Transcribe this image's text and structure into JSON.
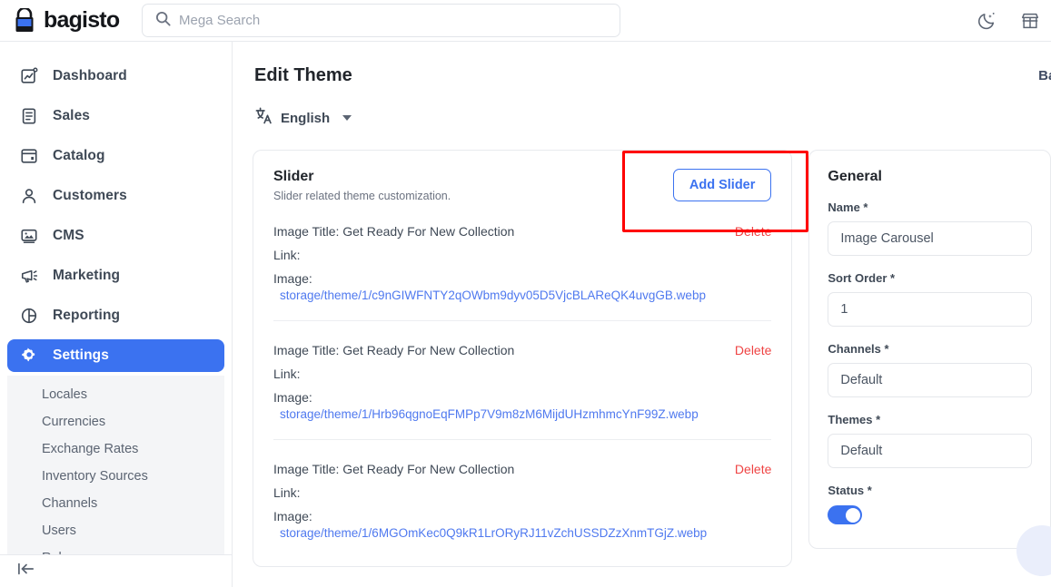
{
  "topbar": {
    "brand_name": "bagisto",
    "brand_icon": "shopping-bag-icon",
    "search_placeholder": "Mega Search",
    "search_value": "",
    "search_icon": "search-icon",
    "dark_mode_icon": "moon-icon",
    "store_icon": "shop-icon"
  },
  "sidebar": {
    "items": [
      {
        "label": "Dashboard",
        "icon": "dashboard-icon",
        "active": false
      },
      {
        "label": "Sales",
        "icon": "sales-icon",
        "active": false
      },
      {
        "label": "Catalog",
        "icon": "catalog-icon",
        "active": false
      },
      {
        "label": "Customers",
        "icon": "customers-icon",
        "active": false
      },
      {
        "label": "CMS",
        "icon": "cms-icon",
        "active": false
      },
      {
        "label": "Marketing",
        "icon": "marketing-icon",
        "active": false
      },
      {
        "label": "Reporting",
        "icon": "reporting-icon",
        "active": false
      },
      {
        "label": "Settings",
        "icon": "gear-icon",
        "active": true
      }
    ],
    "subitems": [
      {
        "label": "Locales"
      },
      {
        "label": "Currencies"
      },
      {
        "label": "Exchange Rates"
      },
      {
        "label": "Inventory Sources"
      },
      {
        "label": "Channels"
      },
      {
        "label": "Users"
      },
      {
        "label": "Roles"
      }
    ],
    "collapse_icon": "collapse-sidebar-icon"
  },
  "page": {
    "title": "Edit Theme",
    "back_label": "Back",
    "locale_label": "English",
    "locale_icon": "translate-icon"
  },
  "slider_panel": {
    "title": "Slider",
    "subtitle": "Slider related theme customization.",
    "add_button_label": "Add Slider",
    "delete_label": "Delete",
    "title_prefix": "Image Title:",
    "link_prefix": "Link:",
    "image_prefix": "Image:",
    "items": [
      {
        "title": "Image Title: Get Ready For New Collection",
        "link": "Link:",
        "image_label": "Image:",
        "image_path": "storage/theme/1/c9nGIWFNTY2qOWbm9dyv05D5VjcBLAReQK4uvgGB.webp",
        "delete": "Delete"
      },
      {
        "title": "Image Title: Get Ready For New Collection",
        "link": "Link:",
        "image_label": "Image:",
        "image_path": "storage/theme/1/Hrb96qgnoEqFMPp7V9m8zM6MijdUHzmhmcYnF99Z.webp",
        "delete": "Delete"
      },
      {
        "title": "Image Title: Get Ready For New Collection",
        "link": "Link:",
        "image_label": "Image:",
        "image_path": "storage/theme/1/6MGOmKec0Q9kR1LrORyRJ11vZchUSSDZzXnmTGjZ.webp",
        "delete": "Delete"
      }
    ]
  },
  "general_panel": {
    "title": "General",
    "fields": [
      {
        "label": "Name *",
        "value": "Image Carousel",
        "type": "text"
      },
      {
        "label": "Sort Order *",
        "value": "1",
        "type": "text"
      },
      {
        "label": "Channels *",
        "value": "Default",
        "type": "select"
      },
      {
        "label": "Themes *",
        "value": "Default",
        "type": "select"
      }
    ],
    "status_label": "Status *",
    "status_on": true
  },
  "colors": {
    "accent": "#3b72f0",
    "link": "#4f79ef",
    "danger": "#ef4444",
    "annotation": "#ff0000",
    "border": "#e8eaee",
    "text": "#3f4956"
  }
}
